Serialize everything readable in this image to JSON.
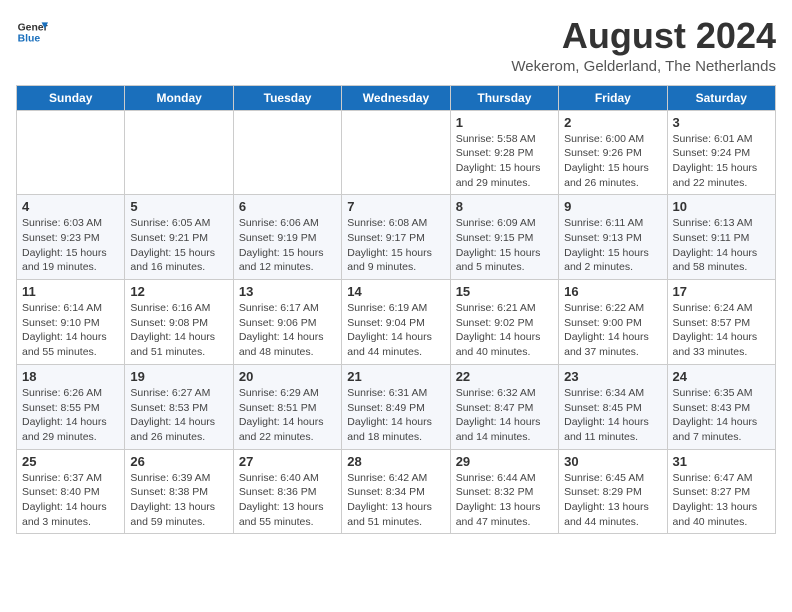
{
  "header": {
    "logo_line1": "General",
    "logo_line2": "Blue",
    "month_year": "August 2024",
    "location": "Wekerom, Gelderland, The Netherlands"
  },
  "calendar": {
    "days_of_week": [
      "Sunday",
      "Monday",
      "Tuesday",
      "Wednesday",
      "Thursday",
      "Friday",
      "Saturday"
    ],
    "weeks": [
      [
        {
          "day": "",
          "detail": ""
        },
        {
          "day": "",
          "detail": ""
        },
        {
          "day": "",
          "detail": ""
        },
        {
          "day": "",
          "detail": ""
        },
        {
          "day": "1",
          "detail": "Sunrise: 5:58 AM\nSunset: 9:28 PM\nDaylight: 15 hours\nand 29 minutes."
        },
        {
          "day": "2",
          "detail": "Sunrise: 6:00 AM\nSunset: 9:26 PM\nDaylight: 15 hours\nand 26 minutes."
        },
        {
          "day": "3",
          "detail": "Sunrise: 6:01 AM\nSunset: 9:24 PM\nDaylight: 15 hours\nand 22 minutes."
        }
      ],
      [
        {
          "day": "4",
          "detail": "Sunrise: 6:03 AM\nSunset: 9:23 PM\nDaylight: 15 hours\nand 19 minutes."
        },
        {
          "day": "5",
          "detail": "Sunrise: 6:05 AM\nSunset: 9:21 PM\nDaylight: 15 hours\nand 16 minutes."
        },
        {
          "day": "6",
          "detail": "Sunrise: 6:06 AM\nSunset: 9:19 PM\nDaylight: 15 hours\nand 12 minutes."
        },
        {
          "day": "7",
          "detail": "Sunrise: 6:08 AM\nSunset: 9:17 PM\nDaylight: 15 hours\nand 9 minutes."
        },
        {
          "day": "8",
          "detail": "Sunrise: 6:09 AM\nSunset: 9:15 PM\nDaylight: 15 hours\nand 5 minutes."
        },
        {
          "day": "9",
          "detail": "Sunrise: 6:11 AM\nSunset: 9:13 PM\nDaylight: 15 hours\nand 2 minutes."
        },
        {
          "day": "10",
          "detail": "Sunrise: 6:13 AM\nSunset: 9:11 PM\nDaylight: 14 hours\nand 58 minutes."
        }
      ],
      [
        {
          "day": "11",
          "detail": "Sunrise: 6:14 AM\nSunset: 9:10 PM\nDaylight: 14 hours\nand 55 minutes."
        },
        {
          "day": "12",
          "detail": "Sunrise: 6:16 AM\nSunset: 9:08 PM\nDaylight: 14 hours\nand 51 minutes."
        },
        {
          "day": "13",
          "detail": "Sunrise: 6:17 AM\nSunset: 9:06 PM\nDaylight: 14 hours\nand 48 minutes."
        },
        {
          "day": "14",
          "detail": "Sunrise: 6:19 AM\nSunset: 9:04 PM\nDaylight: 14 hours\nand 44 minutes."
        },
        {
          "day": "15",
          "detail": "Sunrise: 6:21 AM\nSunset: 9:02 PM\nDaylight: 14 hours\nand 40 minutes."
        },
        {
          "day": "16",
          "detail": "Sunrise: 6:22 AM\nSunset: 9:00 PM\nDaylight: 14 hours\nand 37 minutes."
        },
        {
          "day": "17",
          "detail": "Sunrise: 6:24 AM\nSunset: 8:57 PM\nDaylight: 14 hours\nand 33 minutes."
        }
      ],
      [
        {
          "day": "18",
          "detail": "Sunrise: 6:26 AM\nSunset: 8:55 PM\nDaylight: 14 hours\nand 29 minutes."
        },
        {
          "day": "19",
          "detail": "Sunrise: 6:27 AM\nSunset: 8:53 PM\nDaylight: 14 hours\nand 26 minutes."
        },
        {
          "day": "20",
          "detail": "Sunrise: 6:29 AM\nSunset: 8:51 PM\nDaylight: 14 hours\nand 22 minutes."
        },
        {
          "day": "21",
          "detail": "Sunrise: 6:31 AM\nSunset: 8:49 PM\nDaylight: 14 hours\nand 18 minutes."
        },
        {
          "day": "22",
          "detail": "Sunrise: 6:32 AM\nSunset: 8:47 PM\nDaylight: 14 hours\nand 14 minutes."
        },
        {
          "day": "23",
          "detail": "Sunrise: 6:34 AM\nSunset: 8:45 PM\nDaylight: 14 hours\nand 11 minutes."
        },
        {
          "day": "24",
          "detail": "Sunrise: 6:35 AM\nSunset: 8:43 PM\nDaylight: 14 hours\nand 7 minutes."
        }
      ],
      [
        {
          "day": "25",
          "detail": "Sunrise: 6:37 AM\nSunset: 8:40 PM\nDaylight: 14 hours\nand 3 minutes."
        },
        {
          "day": "26",
          "detail": "Sunrise: 6:39 AM\nSunset: 8:38 PM\nDaylight: 13 hours\nand 59 minutes."
        },
        {
          "day": "27",
          "detail": "Sunrise: 6:40 AM\nSunset: 8:36 PM\nDaylight: 13 hours\nand 55 minutes."
        },
        {
          "day": "28",
          "detail": "Sunrise: 6:42 AM\nSunset: 8:34 PM\nDaylight: 13 hours\nand 51 minutes."
        },
        {
          "day": "29",
          "detail": "Sunrise: 6:44 AM\nSunset: 8:32 PM\nDaylight: 13 hours\nand 47 minutes."
        },
        {
          "day": "30",
          "detail": "Sunrise: 6:45 AM\nSunset: 8:29 PM\nDaylight: 13 hours\nand 44 minutes."
        },
        {
          "day": "31",
          "detail": "Sunrise: 6:47 AM\nSunset: 8:27 PM\nDaylight: 13 hours\nand 40 minutes."
        }
      ]
    ]
  }
}
